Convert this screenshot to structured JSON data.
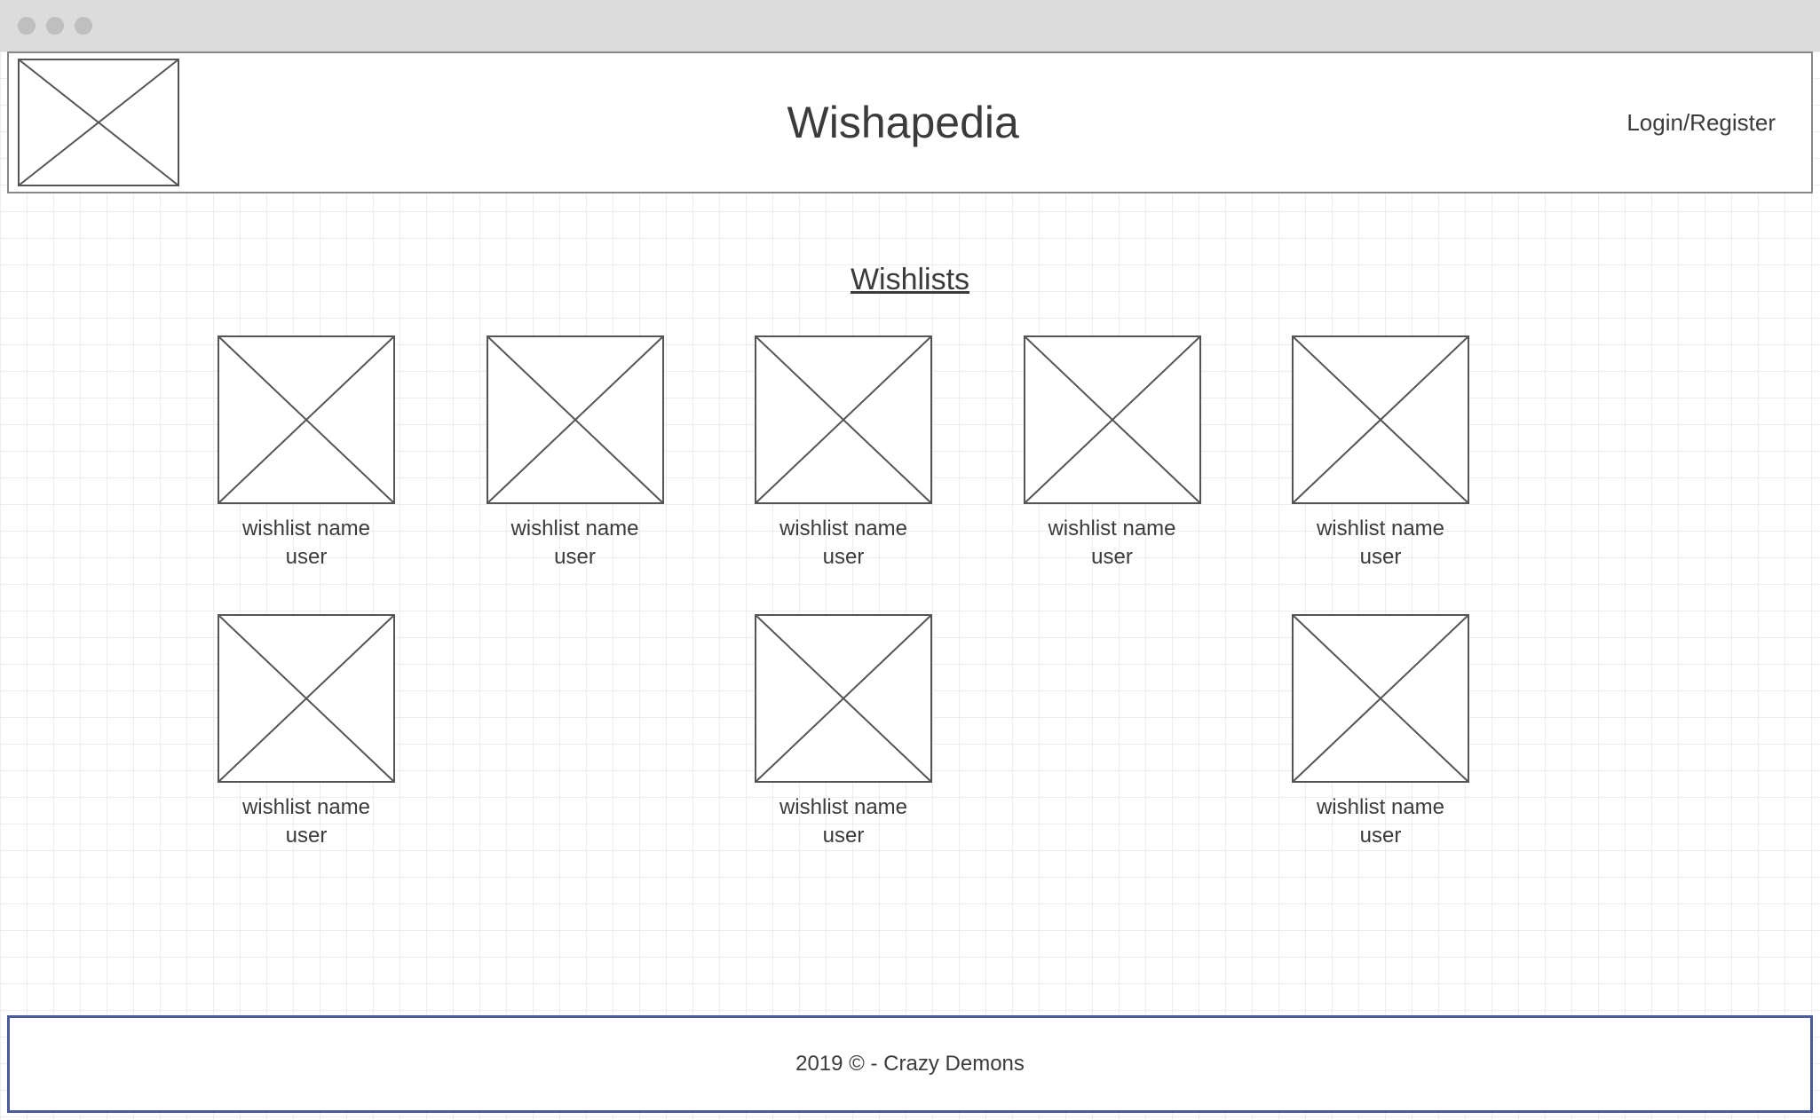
{
  "header": {
    "site_title": "Wishapedia",
    "login_label": "Login/Register"
  },
  "section_title": "Wishlists",
  "wishlists": [
    {
      "name": "wishlist name",
      "user": "user"
    },
    {
      "name": "wishlist name",
      "user": "user"
    },
    {
      "name": "wishlist name",
      "user": "user"
    },
    {
      "name": "wishlist name",
      "user": "user"
    },
    {
      "name": "wishlist name",
      "user": "user"
    },
    {
      "name": "wishlist name",
      "user": "user"
    },
    {
      "name": "wishlist name",
      "user": "user"
    },
    {
      "name": "wishlist name",
      "user": "user"
    }
  ],
  "footer_text": "2019 © - Crazy Demons"
}
